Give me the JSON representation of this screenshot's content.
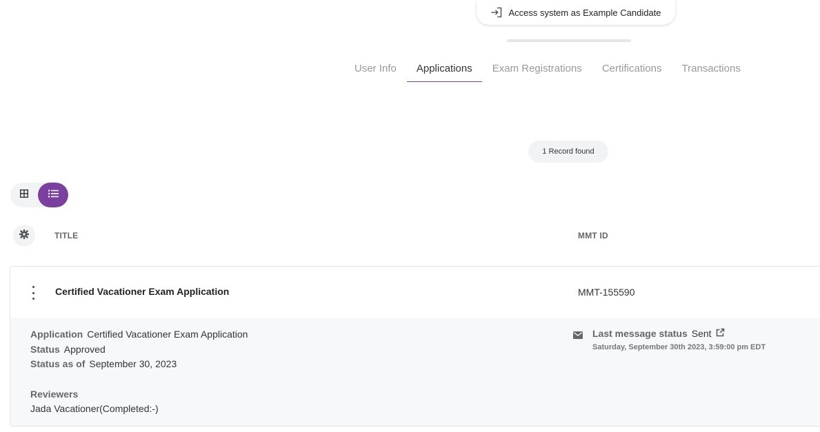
{
  "header": {
    "impersonate_label": "Access system as Example Candidate",
    "impersonate_icon": "login-icon"
  },
  "tabs": [
    {
      "label": "User Info",
      "active": false
    },
    {
      "label": "Applications",
      "active": true
    },
    {
      "label": "Exam Registrations",
      "active": false
    },
    {
      "label": "Certifications",
      "active": false
    },
    {
      "label": "Transactions",
      "active": false
    }
  ],
  "records": {
    "count_label": "1 Record found"
  },
  "view_toggle": {
    "grid_icon": "grid-icon",
    "list_icon": "list-icon",
    "active": "list"
  },
  "table": {
    "settings_icon": "gear-icon",
    "columns": {
      "title": "TITLE",
      "mmt_id": "MMT ID"
    },
    "rows": [
      {
        "title": "Certified Vacationer Exam Application",
        "mmt_id": "MMT-155590",
        "details": {
          "application_label": "Application",
          "application_value": "Certified Vacationer Exam Application",
          "status_label": "Status",
          "status_value": "Approved",
          "status_as_of_label": "Status as of",
          "status_as_of_value": "September 30, 2023",
          "reviewers_label": "Reviewers",
          "reviewers_value": "Jada Vacationer(Completed:-)"
        },
        "message": {
          "label": "Last message status",
          "value": "Sent",
          "timestamp": "Saturday, September 30th 2023, 3:59:00 pm EDT"
        }
      }
    ]
  },
  "colors": {
    "accent": "#7b3fa0",
    "muted_bg": "#f2f3f5",
    "detail_bg": "#f7f8fa"
  }
}
